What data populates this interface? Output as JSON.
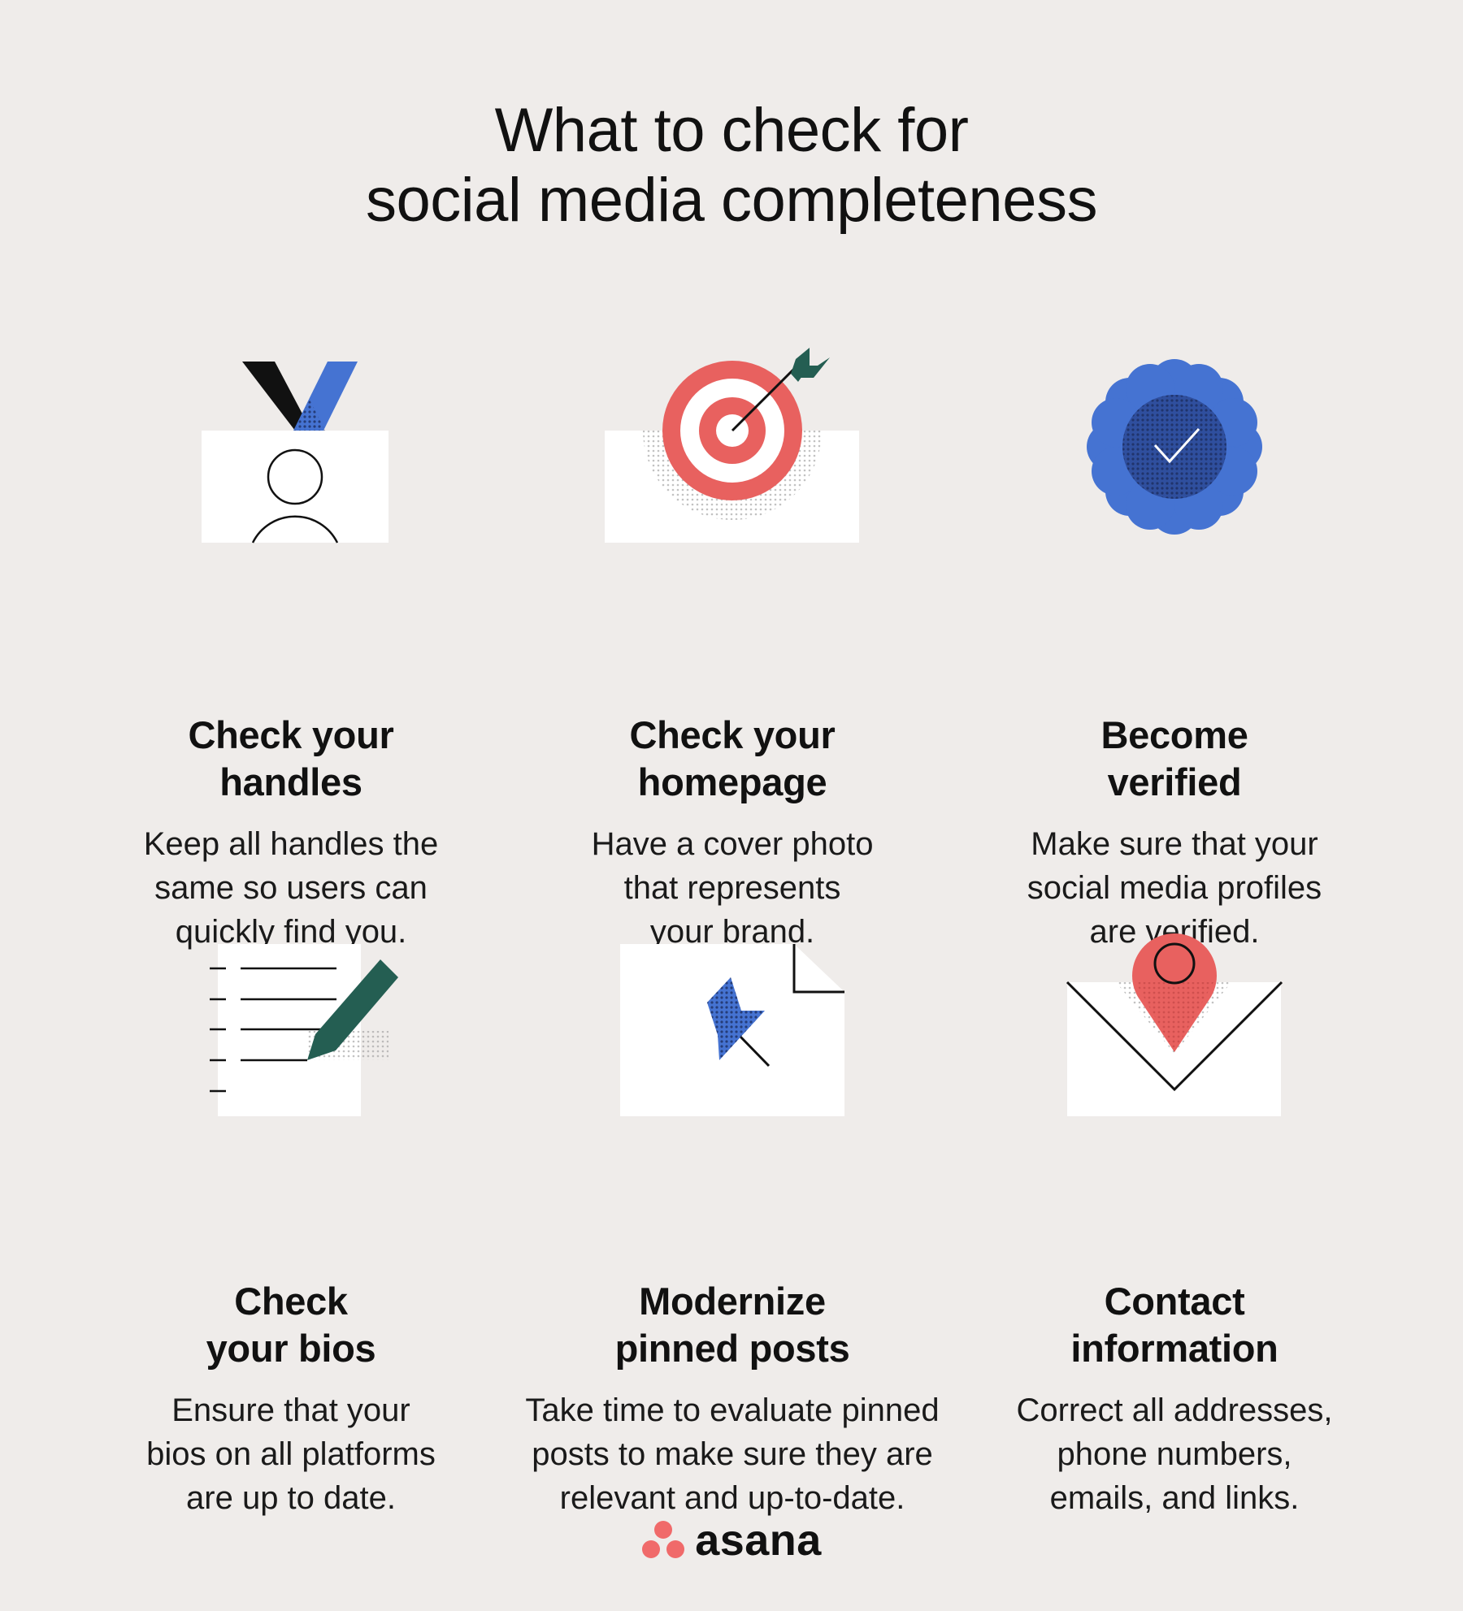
{
  "title": {
    "line1": "What to check for",
    "line2": "social media completeness"
  },
  "colors": {
    "background": "#efecea",
    "coral": "#e8615f",
    "blue": "#4573d2",
    "dark_blue": "#233a78",
    "dark_green": "#245e52",
    "black": "#111111",
    "white": "#ffffff"
  },
  "cards": [
    {
      "icon": "id-badge-icon",
      "heading": [
        "Check your",
        "handles"
      ],
      "body": [
        "Keep all handles the",
        "same so users can",
        "quickly find you."
      ]
    },
    {
      "icon": "target-arrow-icon",
      "heading": [
        "Check your",
        "homepage"
      ],
      "body": [
        "Have a cover photo",
        "that represents",
        "your brand."
      ]
    },
    {
      "icon": "verified-badge-icon",
      "heading": [
        "Become",
        "verified"
      ],
      "body": [
        "Make sure that your",
        "social media profiles",
        "are verified."
      ]
    },
    {
      "icon": "document-pencil-icon",
      "heading": [
        "Check",
        "your bios"
      ],
      "body": [
        "Ensure that your",
        "bios on all platforms",
        "are up to date."
      ]
    },
    {
      "icon": "pushpin-page-icon",
      "heading": [
        "Modernize",
        "pinned posts"
      ],
      "body": [
        "Take time to evaluate pinned",
        "posts to make sure they are",
        "relevant and up-to-date."
      ]
    },
    {
      "icon": "envelope-location-pin-icon",
      "heading": [
        "Contact",
        "information"
      ],
      "body": [
        "Correct all addresses,",
        "phone numbers,",
        "emails, and links."
      ]
    }
  ],
  "footer": {
    "brand": "asana",
    "logo_icon": "asana-logo-icon"
  }
}
